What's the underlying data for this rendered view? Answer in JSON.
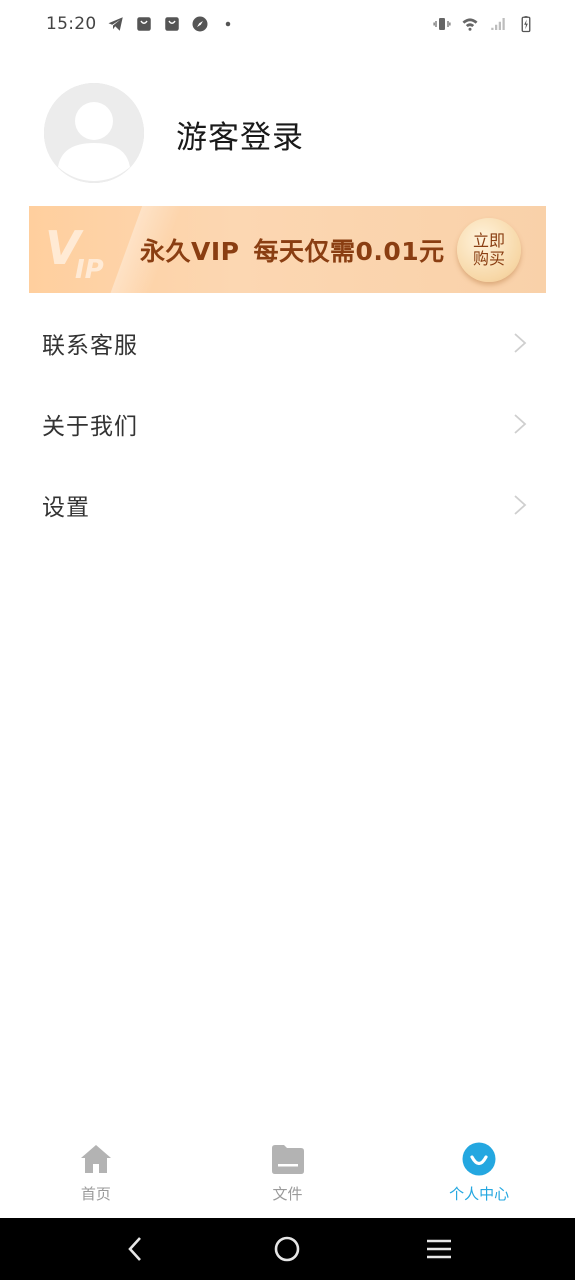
{
  "status_bar": {
    "time": "15:20",
    "icons_left": [
      "telegram-icon",
      "bag-icon",
      "bag-icon",
      "compass-icon",
      "dot-icon"
    ],
    "icons_right": [
      "vibrate-icon",
      "wifi-icon",
      "signal-icon",
      "battery-charging-icon"
    ]
  },
  "profile": {
    "avatar_icon": "default-avatar-icon",
    "login_text": "游客登录"
  },
  "vip_banner": {
    "logo_text": "VIP",
    "part1": "永久VIP",
    "part2": "每天仅需0.01元",
    "buy_line1": "立即",
    "buy_line2": "购买",
    "accent_color": "#8a3e12",
    "bg_color": "#fcd2a8"
  },
  "menu": [
    {
      "label": "联系客服"
    },
    {
      "label": "关于我们"
    },
    {
      "label": "设置"
    }
  ],
  "tabs": [
    {
      "label": "首页",
      "icon": "home-icon",
      "active": false
    },
    {
      "label": "文件",
      "icon": "folder-icon",
      "active": false
    },
    {
      "label": "个人中心",
      "icon": "profile-smile-icon",
      "active": true
    }
  ],
  "colors": {
    "tab_active": "#24a7e0",
    "tab_inactive": "#9a9a9a"
  },
  "nav_bar": [
    "back-icon",
    "home-circle-icon",
    "menu-icon"
  ]
}
